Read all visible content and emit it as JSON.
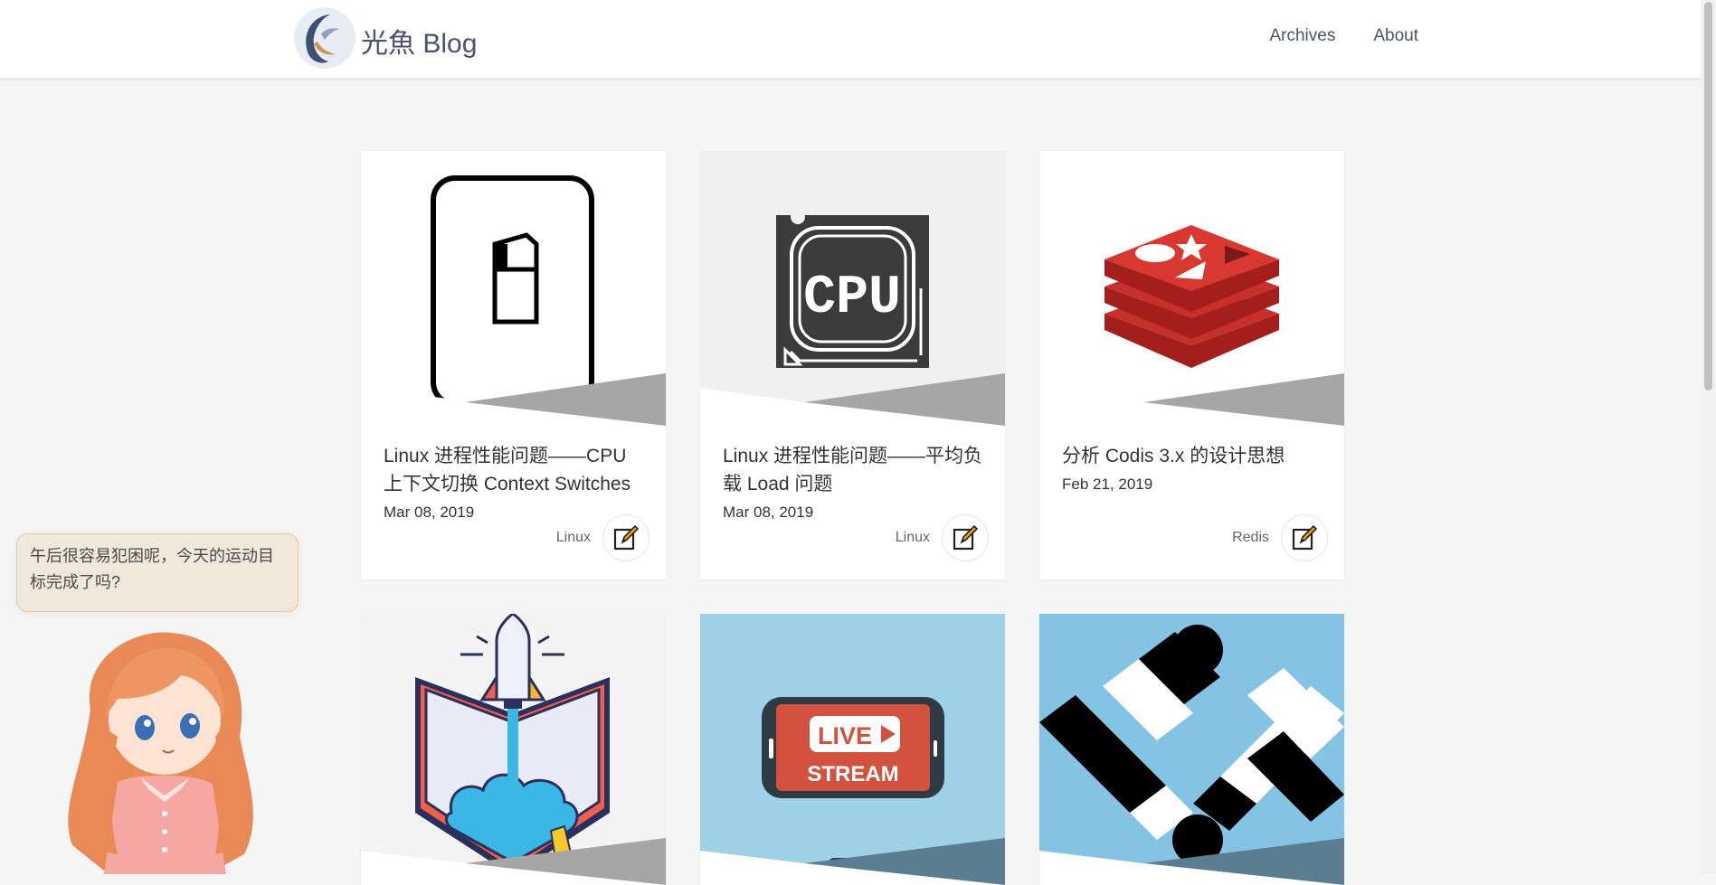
{
  "header": {
    "site_title": "光魚 Blog",
    "nav": [
      "Archives",
      "About"
    ]
  },
  "posts": [
    {
      "title": "Linux 进程性能问题——CPU 上下文切换 Context Switches",
      "date": "Mar 08, 2019",
      "tag": "Linux",
      "image": "switch-icon"
    },
    {
      "title": "Linux 进程性能问题——平均负载 Load 问题",
      "date": "Mar 08, 2019",
      "tag": "Linux",
      "image": "cpu-chip-icon"
    },
    {
      "title": "分析 Codis 3.x 的设计思想",
      "date": "Feb 21, 2019",
      "tag": "Redis",
      "image": "redis-logo"
    },
    {
      "image": "rocket-book-illustration"
    },
    {
      "image": "live-stream-phone-illustration",
      "live_text": "LIVE",
      "stream_text": "STREAM"
    },
    {
      "image": "handshake-illustration"
    }
  ],
  "mascot": {
    "message": "午后很容易犯困呢，今天的运动目标完成了吗?"
  },
  "colors": {
    "accent": "#f39c12",
    "slant": "#a6a6a6",
    "redis": "#c6302b"
  }
}
